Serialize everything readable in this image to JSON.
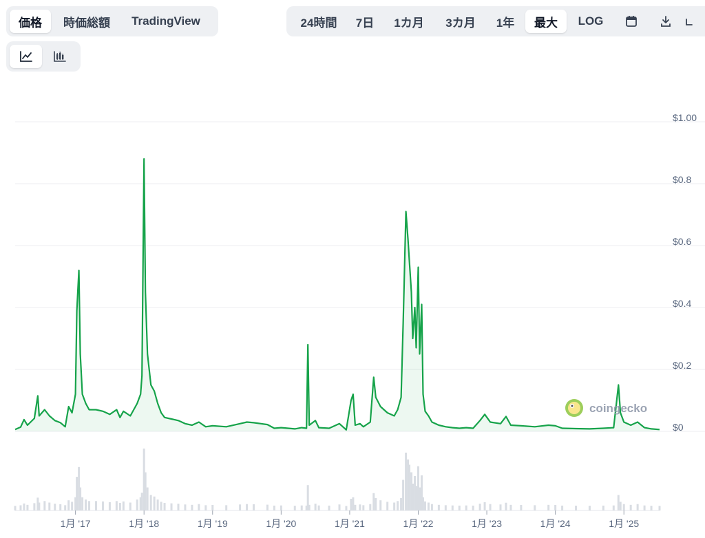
{
  "type_tabs": [
    {
      "label": "価格",
      "active": true
    },
    {
      "label": "時価総額",
      "active": false
    },
    {
      "label": "TradingView",
      "active": false
    }
  ],
  "range_tabs": [
    {
      "label": "24時間",
      "active": false
    },
    {
      "label": "7日",
      "active": false
    },
    {
      "label": "1カ月",
      "active": false
    },
    {
      "label": "3カ月",
      "active": false
    },
    {
      "label": "1年",
      "active": false
    },
    {
      "label": "最大",
      "active": true
    },
    {
      "label": "LOG",
      "active": false
    }
  ],
  "icons": {
    "calendar": "calendar-icon",
    "download": "download-icon",
    "expand": "expand-icon",
    "line_chart": "line-chart-icon",
    "candlestick": "candlestick-icon"
  },
  "watermark": {
    "text": "coingecko"
  },
  "colors": {
    "line": "#16a34a",
    "grid": "#eceef1",
    "axis_text": "#58667e",
    "tab_bg": "#eef0f3",
    "volume": "#d9dde3"
  },
  "chart_data": {
    "type": "line",
    "title": "",
    "xlabel": "",
    "ylabel": "",
    "y_tick_labels": [
      "$1.00",
      "$0.8",
      "$0.6",
      "$0.4",
      "$0.2",
      "$0"
    ],
    "y_ticks": [
      1.0,
      0.8,
      0.6,
      0.4,
      0.2,
      0.0
    ],
    "ylim": [
      0,
      1.0
    ],
    "x_tick_labels": [
      "1月 '17",
      "1月 '18",
      "1月 '19",
      "1月 '20",
      "1月 '21",
      "1月 '22",
      "1月 '23",
      "1月 '24",
      "1月 '25"
    ],
    "x_ticks": [
      2017.0,
      2018.0,
      2019.0,
      2020.0,
      2021.0,
      2022.0,
      2023.0,
      2024.0,
      2025.0
    ],
    "xlim": [
      2016.12,
      2025.52
    ],
    "grid": true,
    "series": [
      {
        "values": [
          [
            2016.12,
            0.006
          ],
          [
            2016.2,
            0.014
          ],
          [
            2016.25,
            0.038
          ],
          [
            2016.3,
            0.02
          ],
          [
            2016.4,
            0.042
          ],
          [
            2016.45,
            0.115
          ],
          [
            2016.47,
            0.05
          ],
          [
            2016.55,
            0.07
          ],
          [
            2016.62,
            0.05
          ],
          [
            2016.7,
            0.035
          ],
          [
            2016.78,
            0.028
          ],
          [
            2016.85,
            0.015
          ],
          [
            2016.9,
            0.08
          ],
          [
            2016.95,
            0.06
          ],
          [
            2017.0,
            0.12
          ],
          [
            2017.02,
            0.39
          ],
          [
            2017.05,
            0.52
          ],
          [
            2017.07,
            0.25
          ],
          [
            2017.1,
            0.12
          ],
          [
            2017.15,
            0.09
          ],
          [
            2017.2,
            0.07
          ],
          [
            2017.3,
            0.07
          ],
          [
            2017.4,
            0.065
          ],
          [
            2017.5,
            0.055
          ],
          [
            2017.6,
            0.07
          ],
          [
            2017.65,
            0.045
          ],
          [
            2017.7,
            0.065
          ],
          [
            2017.8,
            0.05
          ],
          [
            2017.9,
            0.09
          ],
          [
            2017.95,
            0.12
          ],
          [
            2017.97,
            0.18
          ],
          [
            2018.0,
            0.88
          ],
          [
            2018.02,
            0.45
          ],
          [
            2018.05,
            0.25
          ],
          [
            2018.1,
            0.15
          ],
          [
            2018.15,
            0.13
          ],
          [
            2018.2,
            0.09
          ],
          [
            2018.25,
            0.06
          ],
          [
            2018.3,
            0.045
          ],
          [
            2018.4,
            0.04
          ],
          [
            2018.5,
            0.035
          ],
          [
            2018.6,
            0.025
          ],
          [
            2018.7,
            0.02
          ],
          [
            2018.8,
            0.03
          ],
          [
            2018.9,
            0.015
          ],
          [
            2019.0,
            0.018
          ],
          [
            2019.2,
            0.015
          ],
          [
            2019.4,
            0.025
          ],
          [
            2019.5,
            0.03
          ],
          [
            2019.6,
            0.028
          ],
          [
            2019.8,
            0.022
          ],
          [
            2019.9,
            0.01
          ],
          [
            2020.0,
            0.012
          ],
          [
            2020.2,
            0.008
          ],
          [
            2020.3,
            0.012
          ],
          [
            2020.37,
            0.01
          ],
          [
            2020.39,
            0.28
          ],
          [
            2020.41,
            0.02
          ],
          [
            2020.5,
            0.035
          ],
          [
            2020.55,
            0.012
          ],
          [
            2020.7,
            0.01
          ],
          [
            2020.85,
            0.025
          ],
          [
            2020.95,
            0.005
          ],
          [
            2021.02,
            0.1
          ],
          [
            2021.05,
            0.12
          ],
          [
            2021.08,
            0.02
          ],
          [
            2021.15,
            0.025
          ],
          [
            2021.2,
            0.015
          ],
          [
            2021.3,
            0.03
          ],
          [
            2021.35,
            0.175
          ],
          [
            2021.38,
            0.11
          ],
          [
            2021.45,
            0.08
          ],
          [
            2021.55,
            0.06
          ],
          [
            2021.65,
            0.05
          ],
          [
            2021.7,
            0.07
          ],
          [
            2021.75,
            0.11
          ],
          [
            2021.78,
            0.35
          ],
          [
            2021.82,
            0.71
          ],
          [
            2021.85,
            0.62
          ],
          [
            2021.87,
            0.55
          ],
          [
            2021.9,
            0.45
          ],
          [
            2021.92,
            0.3
          ],
          [
            2021.95,
            0.4
          ],
          [
            2021.97,
            0.27
          ],
          [
            2022.0,
            0.53
          ],
          [
            2022.02,
            0.25
          ],
          [
            2022.05,
            0.41
          ],
          [
            2022.07,
            0.12
          ],
          [
            2022.1,
            0.065
          ],
          [
            2022.15,
            0.05
          ],
          [
            2022.2,
            0.03
          ],
          [
            2022.3,
            0.02
          ],
          [
            2022.4,
            0.015
          ],
          [
            2022.5,
            0.012
          ],
          [
            2022.6,
            0.01
          ],
          [
            2022.7,
            0.012
          ],
          [
            2022.8,
            0.01
          ],
          [
            2022.9,
            0.035
          ],
          [
            2022.97,
            0.055
          ],
          [
            2023.05,
            0.03
          ],
          [
            2023.2,
            0.025
          ],
          [
            2023.28,
            0.048
          ],
          [
            2023.35,
            0.02
          ],
          [
            2023.5,
            0.018
          ],
          [
            2023.7,
            0.015
          ],
          [
            2023.9,
            0.02
          ],
          [
            2024.0,
            0.018
          ],
          [
            2024.1,
            0.01
          ],
          [
            2024.3,
            0.009
          ],
          [
            2024.5,
            0.008
          ],
          [
            2024.7,
            0.01
          ],
          [
            2024.85,
            0.012
          ],
          [
            2024.92,
            0.15
          ],
          [
            2024.95,
            0.06
          ],
          [
            2025.0,
            0.03
          ],
          [
            2025.1,
            0.02
          ],
          [
            2025.2,
            0.03
          ],
          [
            2025.3,
            0.012
          ],
          [
            2025.4,
            0.008
          ],
          [
            2025.52,
            0.006
          ]
        ]
      }
    ]
  }
}
